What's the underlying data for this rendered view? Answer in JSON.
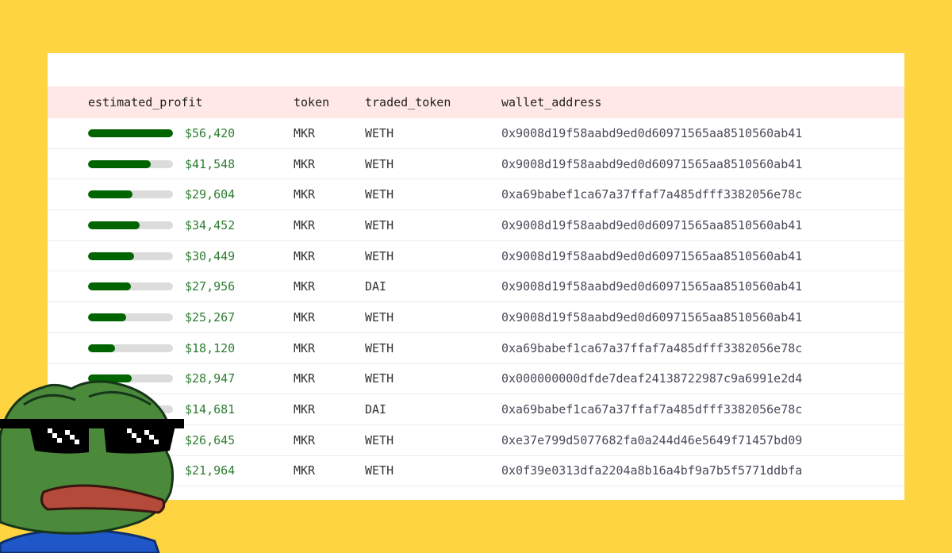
{
  "table": {
    "headers": {
      "estimated_profit": "estimated_profit",
      "token": "token",
      "traded_token": "traded_token",
      "wallet_address": "wallet_address"
    },
    "rows": [
      {
        "profit": "$56,420",
        "fill": 1.0,
        "token": "MKR",
        "traded_token": "WETH",
        "wallet": "0x9008d19f58aabd9ed0d60971565aa8510560ab41"
      },
      {
        "profit": "$41,548",
        "fill": 0.74,
        "token": "MKR",
        "traded_token": "WETH",
        "wallet": "0x9008d19f58aabd9ed0d60971565aa8510560ab41"
      },
      {
        "profit": "$29,604",
        "fill": 0.52,
        "token": "MKR",
        "traded_token": "WETH",
        "wallet": "0xa69babef1ca67a37ffaf7a485dfff3382056e78c"
      },
      {
        "profit": "$34,452",
        "fill": 0.61,
        "token": "MKR",
        "traded_token": "WETH",
        "wallet": "0x9008d19f58aabd9ed0d60971565aa8510560ab41"
      },
      {
        "profit": "$30,449",
        "fill": 0.54,
        "token": "MKR",
        "traded_token": "WETH",
        "wallet": "0x9008d19f58aabd9ed0d60971565aa8510560ab41"
      },
      {
        "profit": "$27,956",
        "fill": 0.5,
        "token": "MKR",
        "traded_token": "DAI",
        "wallet": "0x9008d19f58aabd9ed0d60971565aa8510560ab41"
      },
      {
        "profit": "$25,267",
        "fill": 0.45,
        "token": "MKR",
        "traded_token": "WETH",
        "wallet": "0x9008d19f58aabd9ed0d60971565aa8510560ab41"
      },
      {
        "profit": "$18,120",
        "fill": 0.32,
        "token": "MKR",
        "traded_token": "WETH",
        "wallet": "0xa69babef1ca67a37ffaf7a485dfff3382056e78c"
      },
      {
        "profit": "$28,947",
        "fill": 0.51,
        "token": "MKR",
        "traded_token": "WETH",
        "wallet": "0x000000000dfde7deaf24138722987c9a6991e2d4"
      },
      {
        "profit": "$14,681",
        "fill": 0.26,
        "token": "MKR",
        "traded_token": "DAI",
        "wallet": "0xa69babef1ca67a37ffaf7a485dfff3382056e78c"
      },
      {
        "profit": "$26,645",
        "fill": 0.47,
        "token": "MKR",
        "traded_token": "WETH",
        "wallet": "0xe37e799d5077682fa0a244d46e5649f71457bd09"
      },
      {
        "profit": "$21,964",
        "fill": 0.39,
        "token": "MKR",
        "traded_token": "WETH",
        "wallet": "0x0f39e0313dfa2204a8b16a4bf9a7b5f5771ddbfa"
      }
    ]
  },
  "colors": {
    "background": "#fed540",
    "header_row": "#ffe8e6",
    "bar_fill": "#006400",
    "bar_track": "#dcdcdc",
    "profit_text": "#2e7d32"
  },
  "icons": {
    "sticker": "pepe-frog-sunglasses-icon"
  }
}
